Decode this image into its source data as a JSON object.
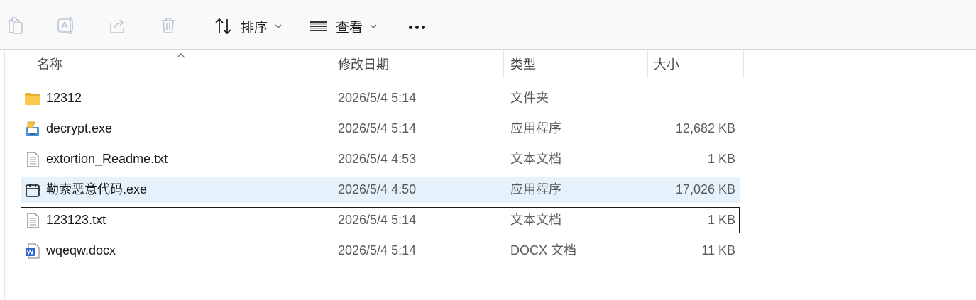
{
  "toolbar": {
    "actions": [
      {
        "icon": "clipboard-icon",
        "label": ""
      },
      {
        "icon": "rename-icon",
        "label": ""
      },
      {
        "icon": "share-icon",
        "label": ""
      },
      {
        "icon": "delete-icon",
        "label": ""
      }
    ],
    "sort_label": "排序",
    "view_label": "查看"
  },
  "columns": {
    "name": "名称",
    "modified": "修改日期",
    "type": "类型",
    "size": "大小"
  },
  "files": [
    {
      "name": "12312",
      "modified": "2026/5/4 5:14",
      "type": "文件夹",
      "size": "",
      "icon": "folder-icon"
    },
    {
      "name": "decrypt.exe",
      "modified": "2026/5/4 5:14",
      "type": "应用程序",
      "size": "12,682 KB",
      "icon": "installer-icon"
    },
    {
      "name": "extortion_Readme.txt",
      "modified": "2026/5/4 4:53",
      "type": "文本文档",
      "size": "1 KB",
      "icon": "text-file-icon"
    },
    {
      "name": "勒索恶意代码.exe",
      "modified": "2026/5/4 4:50",
      "type": "应用程序",
      "size": "17,026 KB",
      "icon": "calendar-app-icon"
    },
    {
      "name": "123123.txt",
      "modified": "2026/5/4 5:14",
      "type": "文本文档",
      "size": "1 KB",
      "icon": "text-file-icon"
    },
    {
      "name": "wqeqw.docx",
      "modified": "2026/5/4 5:14",
      "type": "DOCX 文档",
      "size": "11 KB",
      "icon": "word-doc-icon"
    }
  ],
  "selected_row": 3,
  "focused_row": 4,
  "colors": {
    "selection": "#e5f1fb",
    "folder": "#f8c94a",
    "word": "#2b65c9",
    "toolbar_bg": "#f9f9f9"
  }
}
